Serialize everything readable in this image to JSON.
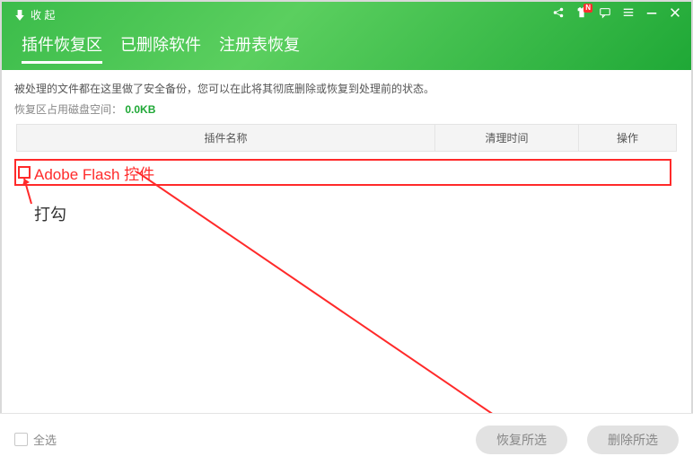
{
  "header": {
    "collapse_label": "收 起",
    "tabs": [
      "插件恢复区",
      "已删除软件",
      "注册表恢复"
    ],
    "active_tab": 0
  },
  "window_badge": "N",
  "info": {
    "desc": "被处理的文件都在这里做了安全备份，您可以在此将其彻底删除或恢复到处理前的状态。",
    "disk_label": "恢复区占用磁盘空间：",
    "disk_size": "0.0KB"
  },
  "table_headers": {
    "name": "插件名称",
    "time": "清理时间",
    "action": "操作"
  },
  "rows": [
    {
      "name": "Adobe Flash 控件"
    }
  ],
  "annotations": {
    "check_label": "打勾"
  },
  "footer": {
    "select_all": "全选",
    "restore_btn": "恢复所选",
    "delete_btn": "删除所选"
  }
}
